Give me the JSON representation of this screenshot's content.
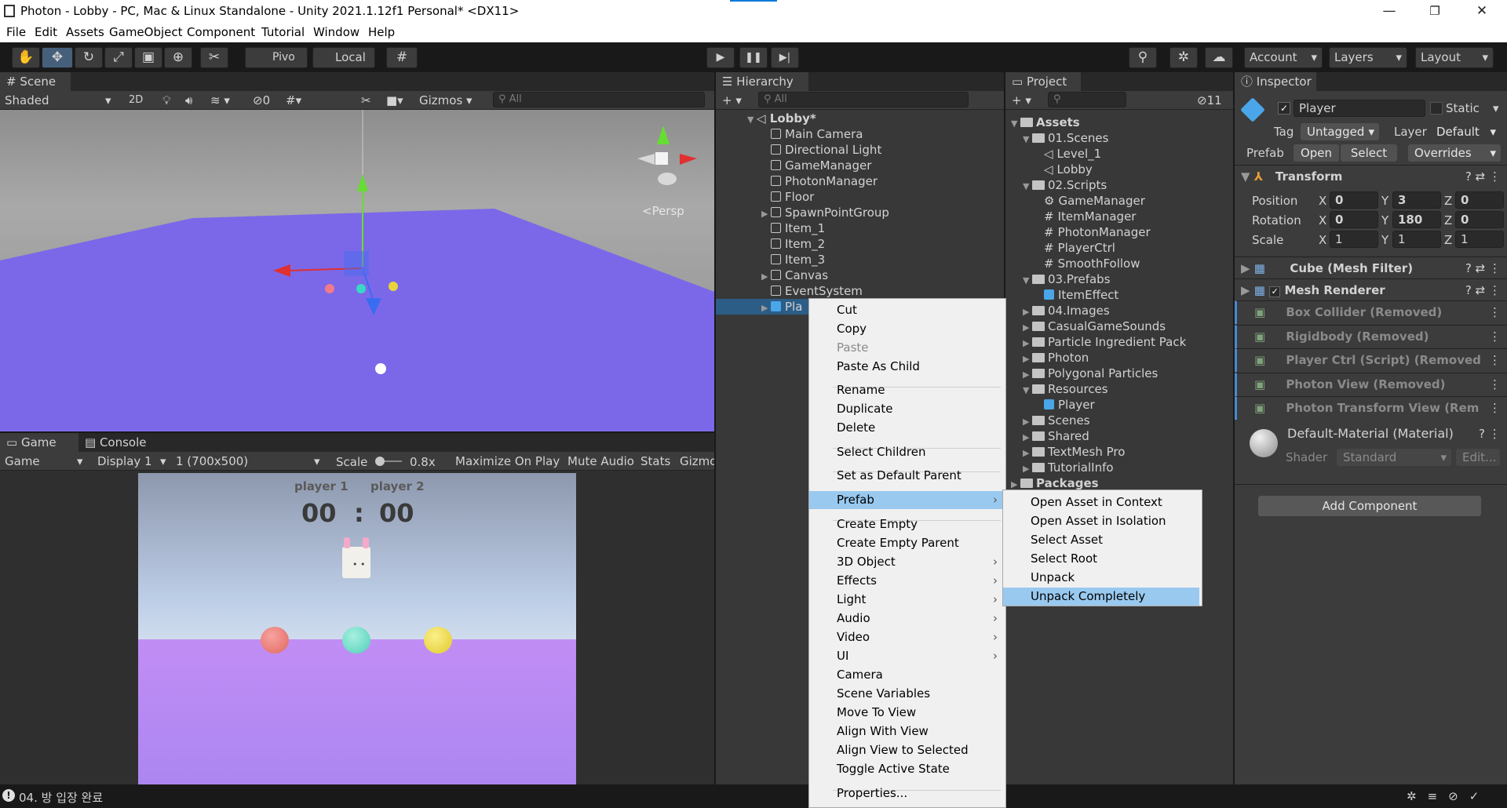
{
  "title": "Photon - Lobby - PC, Mac & Linux Standalone - Unity 2021.1.12f1 Personal* <DX11>",
  "menu": [
    "File",
    "Edit",
    "Assets",
    "GameObject",
    "Component",
    "Tutorial",
    "Window",
    "Help"
  ],
  "toolbar": {
    "pivot": "Pivo",
    "local": "Local",
    "account": "Account",
    "layers": "Layers",
    "layout": "Layout",
    "collab_count": "11"
  },
  "scene": {
    "tab": "Scene",
    "shading": "Shaded",
    "mode2d": "2D",
    "hidden_count": "0",
    "gizmos": "Gizmos",
    "search": "All",
    "persp": "<Persp"
  },
  "game": {
    "tab": "Game",
    "console_tab": "Console",
    "mode": "Game",
    "display": "Display 1",
    "resolution": "1 (700x500)",
    "scale_label": "Scale",
    "scale_value": "0.8x",
    "max": "Maximize On Play",
    "mute": "Mute Audio",
    "stats": "Stats",
    "gizmos": "Gizmo",
    "player1": "player 1",
    "player2": "player 2",
    "score1": "00",
    "colon": ":",
    "score2": "00"
  },
  "hierarchy": {
    "tab": "Hierarchy",
    "search": "All",
    "root": "Lobby*",
    "items": [
      "Main Camera",
      "Directional Light",
      "GameManager",
      "PhotonManager",
      "Floor",
      "SpawnPointGroup",
      "Item_1",
      "Item_2",
      "Item_3",
      "Canvas",
      "EventSystem",
      "Pla"
    ]
  },
  "context": {
    "items": [
      "Cut",
      "Copy",
      "Paste",
      "Paste As Child",
      "Rename",
      "Duplicate",
      "Delete",
      "Select Children",
      "Set as Default Parent",
      "Prefab",
      "Create Empty",
      "Create Empty Parent",
      "3D Object",
      "Effects",
      "Light",
      "Audio",
      "Video",
      "UI",
      "Camera",
      "Scene Variables",
      "Move To View",
      "Align With View",
      "Align View to Selected",
      "Toggle Active State",
      "Properties..."
    ]
  },
  "submenu": {
    "items": [
      "Open Asset in Context",
      "Open Asset in Isolation",
      "Select Asset",
      "Select Root",
      "Unpack",
      "Unpack Completely"
    ]
  },
  "project": {
    "tab": "Project",
    "count": "11",
    "tree": [
      "Assets",
      "01.Scenes",
      "Level_1",
      "Lobby",
      "02.Scripts",
      "GameManager",
      "ItemManager",
      "PhotonManager",
      "PlayerCtrl",
      "SmoothFollow",
      "03.Prefabs",
      "ItemEffect",
      "04.Images",
      "CasualGameSounds",
      "Particle Ingredient Pack",
      "Photon",
      "Polygonal Particles",
      "Resources",
      "Player",
      "Scenes",
      "Shared",
      "TextMesh Pro",
      "TutorialInfo",
      "Packages"
    ]
  },
  "inspector": {
    "tab": "Inspector",
    "name": "Player",
    "static": "Static",
    "tag_label": "Tag",
    "tag": "Untagged",
    "layer_label": "Layer",
    "layer": "Default",
    "prefab_label": "Prefab",
    "open": "Open",
    "select": "Select",
    "overrides": "Overrides",
    "transform": "Transform",
    "position": "Position",
    "rotation": "Rotation",
    "scale": "Scale",
    "pos": [
      "0",
      "3",
      "0"
    ],
    "rot": [
      "0",
      "180",
      "0"
    ],
    "scl": [
      "1",
      "1",
      "1"
    ],
    "axes": [
      "X",
      "Y",
      "Z"
    ],
    "components": [
      "Cube (Mesh Filter)",
      "Mesh Renderer",
      "Box Collider (Removed)",
      "Rigidbody (Removed)",
      "Player Ctrl (Script) (Removed",
      "Photon View (Removed)",
      "Photon Transform View (Rem"
    ],
    "material": "Default-Material (Material)",
    "shader_label": "Shader",
    "shader": "Standard",
    "edit": "Edit...",
    "add": "Add Component"
  },
  "status": "04. 방 입장 완료",
  "colors": {
    "accent": "#99c9ef",
    "plane": "#7b68e8",
    "selected": "#2c5d87"
  }
}
